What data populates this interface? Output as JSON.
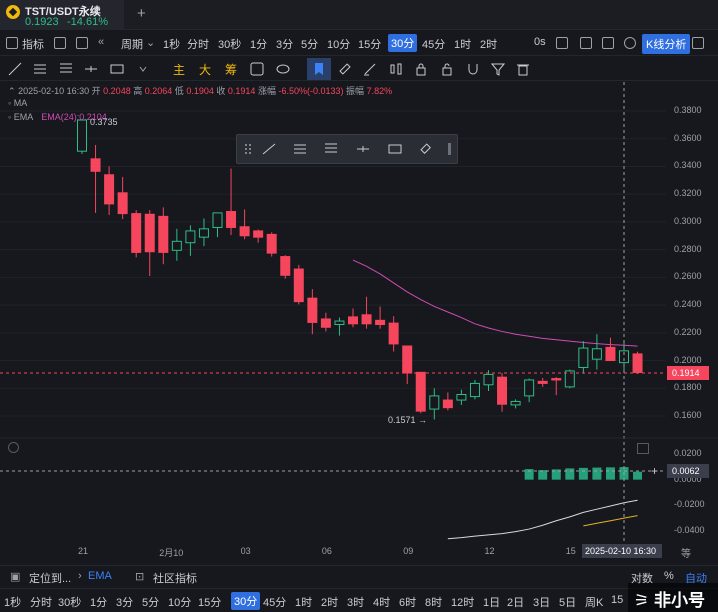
{
  "tab": {
    "symbol": "TST/USDT永续",
    "price": "0.1923",
    "change": "-14.61%"
  },
  "toolbar": {
    "indicators": "指标",
    "period": "周期",
    "intervals": [
      "1秒",
      "分时",
      "30秒",
      "1分",
      "3分",
      "5分",
      "10分",
      "15分",
      "30分",
      "45分",
      "1时",
      "2时"
    ],
    "active_interval": "30分",
    "countdown": "0s",
    "kline_analysis": "K线分析"
  },
  "drawing_toolbar": {
    "labels": [
      "主",
      "大",
      "筹"
    ]
  },
  "ohlc": {
    "datetime": "2025-02-10 16:30",
    "open_label": "开",
    "open": "0.2048",
    "high_label": "高",
    "high": "0.2064",
    "low_label": "低",
    "low": "0.1904",
    "close_label": "收",
    "close": "0.1914",
    "change_label": "涨幅",
    "change": "-6.50%(-0.0133)",
    "amplitude_label": "振幅",
    "amplitude": "7.82%"
  },
  "legend": {
    "ma": "MA",
    "ema": "EMA",
    "ema_params": "EMA(24):0.2104"
  },
  "markers": {
    "high": "0.3735",
    "low": "0.1571 →"
  },
  "yaxis": [
    "0.3800",
    "0.3600",
    "0.3400",
    "0.3200",
    "0.3000",
    "0.2800",
    "0.2600",
    "0.2400",
    "0.2200",
    "0.2000",
    "0.1800",
    "0.1600"
  ],
  "yaxis_sub": [
    "0.0200",
    "0.0000",
    "-0.0200",
    "-0.0400"
  ],
  "last_price": "0.1914",
  "crosshair_value": "0.0062",
  "crosshair_date": "2025-02-10 16:30",
  "xaxis": [
    "21",
    "2月10",
    "03",
    "06",
    "09",
    "12",
    "15"
  ],
  "eq_label": "等",
  "bottom_bar": {
    "position": "定位到...",
    "ema": "EMA",
    "community": "社区指标",
    "log": "对数",
    "percent": "%",
    "auto": "自动"
  },
  "bottom_intervals": [
    "1秒",
    "分时",
    "30秒",
    "1分",
    "3分",
    "5分",
    "10分",
    "15分",
    "30分",
    "45分",
    "1时",
    "2时",
    "3时",
    "4时",
    "6时",
    "8时",
    "12时",
    "1日",
    "2日",
    "3日",
    "5日",
    "周K",
    "15"
  ],
  "bottom_active": "30分",
  "watermark": "非小号",
  "chart_data": {
    "type": "candlestick",
    "candles": [
      {
        "o": 0.351,
        "h": 0.3735,
        "l": 0.349,
        "c": 0.3735
      },
      {
        "o": 0.3455,
        "h": 0.3555,
        "l": 0.3065,
        "c": 0.3365
      },
      {
        "o": 0.334,
        "h": 0.34,
        "l": 0.305,
        "c": 0.313
      },
      {
        "o": 0.321,
        "h": 0.3325,
        "l": 0.302,
        "c": 0.306
      },
      {
        "o": 0.306,
        "h": 0.3085,
        "l": 0.2745,
        "c": 0.278
      },
      {
        "o": 0.3055,
        "h": 0.3085,
        "l": 0.261,
        "c": 0.2785
      },
      {
        "o": 0.304,
        "h": 0.3105,
        "l": 0.2695,
        "c": 0.278
      },
      {
        "o": 0.2795,
        "h": 0.295,
        "l": 0.272,
        "c": 0.286
      },
      {
        "o": 0.285,
        "h": 0.2975,
        "l": 0.2755,
        "c": 0.2935
      },
      {
        "o": 0.289,
        "h": 0.3025,
        "l": 0.2825,
        "c": 0.295
      },
      {
        "o": 0.296,
        "h": 0.305,
        "l": 0.289,
        "c": 0.3065
      },
      {
        "o": 0.3075,
        "h": 0.3385,
        "l": 0.2905,
        "c": 0.296
      },
      {
        "o": 0.2965,
        "h": 0.309,
        "l": 0.2875,
        "c": 0.29
      },
      {
        "o": 0.2935,
        "h": 0.2945,
        "l": 0.285,
        "c": 0.289
      },
      {
        "o": 0.291,
        "h": 0.2925,
        "l": 0.275,
        "c": 0.2775
      },
      {
        "o": 0.275,
        "h": 0.276,
        "l": 0.259,
        "c": 0.2615
      },
      {
        "o": 0.266,
        "h": 0.269,
        "l": 0.2405,
        "c": 0.2425
      },
      {
        "o": 0.245,
        "h": 0.2515,
        "l": 0.219,
        "c": 0.2275
      },
      {
        "o": 0.23,
        "h": 0.2345,
        "l": 0.221,
        "c": 0.224
      },
      {
        "o": 0.226,
        "h": 0.231,
        "l": 0.218,
        "c": 0.2285
      },
      {
        "o": 0.2315,
        "h": 0.2375,
        "l": 0.224,
        "c": 0.2265
      },
      {
        "o": 0.233,
        "h": 0.246,
        "l": 0.223,
        "c": 0.2265
      },
      {
        "o": 0.229,
        "h": 0.239,
        "l": 0.223,
        "c": 0.226
      },
      {
        "o": 0.227,
        "h": 0.232,
        "l": 0.2065,
        "c": 0.212
      },
      {
        "o": 0.2105,
        "h": 0.2105,
        "l": 0.183,
        "c": 0.191
      },
      {
        "o": 0.1915,
        "h": 0.1915,
        "l": 0.162,
        "c": 0.1635
      },
      {
        "o": 0.165,
        "h": 0.18,
        "l": 0.1575,
        "c": 0.1745
      },
      {
        "o": 0.1715,
        "h": 0.177,
        "l": 0.164,
        "c": 0.166
      },
      {
        "o": 0.1715,
        "h": 0.179,
        "l": 0.168,
        "c": 0.1755
      },
      {
        "o": 0.174,
        "h": 0.186,
        "l": 0.172,
        "c": 0.1835
      },
      {
        "o": 0.1825,
        "h": 0.193,
        "l": 0.178,
        "c": 0.19
      },
      {
        "o": 0.188,
        "h": 0.191,
        "l": 0.163,
        "c": 0.1685
      },
      {
        "o": 0.168,
        "h": 0.172,
        "l": 0.1655,
        "c": 0.1705
      },
      {
        "o": 0.1745,
        "h": 0.187,
        "l": 0.17,
        "c": 0.186
      },
      {
        "o": 0.185,
        "h": 0.1875,
        "l": 0.181,
        "c": 0.1835
      },
      {
        "o": 0.187,
        "h": 0.188,
        "l": 0.175,
        "c": 0.186
      },
      {
        "o": 0.181,
        "h": 0.1935,
        "l": 0.18,
        "c": 0.1925
      },
      {
        "o": 0.195,
        "h": 0.214,
        "l": 0.1905,
        "c": 0.209
      },
      {
        "o": 0.201,
        "h": 0.219,
        "l": 0.1935,
        "c": 0.2085
      },
      {
        "o": 0.2095,
        "h": 0.2165,
        "l": 0.2025,
        "c": 0.2
      },
      {
        "o": 0.1985,
        "h": 0.213,
        "l": 0.1915,
        "c": 0.207
      },
      {
        "o": 0.2048,
        "h": 0.2064,
        "l": 0.1904,
        "c": 0.1914
      }
    ],
    "ema": [
      0.2725,
      0.268,
      0.2625,
      0.256,
      0.2495,
      0.244,
      0.239,
      0.235,
      0.231,
      0.2265,
      0.2235,
      0.221,
      0.219,
      0.2175,
      0.216,
      0.215,
      0.214,
      0.213,
      0.2122,
      0.2115,
      0.211,
      0.2104
    ],
    "macd_hist": [
      0.0082,
      0.0074,
      0.008,
      0.0088,
      0.0092,
      0.0094,
      0.0096,
      0.0098,
      0.0062
    ],
    "dif": [
      -0.046,
      -0.0452,
      -0.044,
      -0.043,
      -0.042,
      -0.0405,
      -0.0385,
      -0.0355,
      -0.032,
      -0.029,
      -0.0255,
      -0.023,
      -0.0205,
      -0.018,
      -0.016
    ],
    "dea": [
      -0.036,
      -0.034,
      -0.032,
      -0.03,
      -0.028
    ]
  }
}
